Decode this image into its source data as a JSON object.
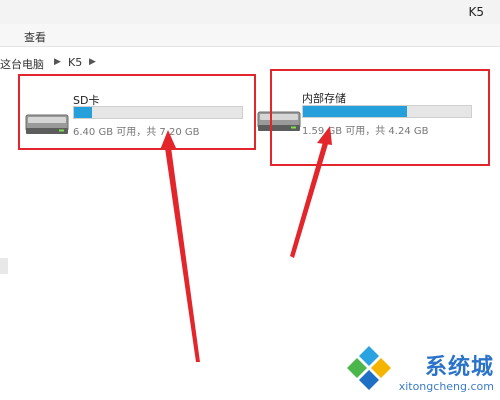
{
  "window": {
    "title": "K5"
  },
  "ribbon": {
    "tab_view": "查看"
  },
  "breadcrumb": {
    "items": [
      "这台电脑",
      "K5"
    ]
  },
  "drives": [
    {
      "name": "SD卡",
      "usage_fraction": 0.11,
      "info": "6.40 GB 可用，共 7.20 GB"
    },
    {
      "name": "内部存储",
      "usage_fraction": 0.62,
      "info": "1.59 GB 可用，共 4.24 GB"
    }
  ],
  "annotations": {
    "color": "#e3262b"
  },
  "watermark": {
    "text": "系统城",
    "url": "xitongcheng.com"
  },
  "colors": {
    "usage_bar": "#26a0da"
  }
}
